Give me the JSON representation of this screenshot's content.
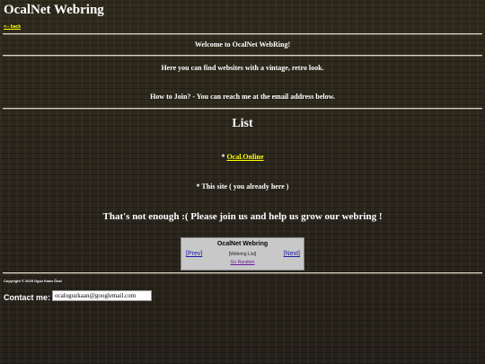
{
  "header": {
    "title": "OcalNet Webring",
    "back_label": "<-- back"
  },
  "intro": {
    "welcome": "Welcome to OcalNet WebRing!",
    "find": "Here you can find websites with a vintage, retro look.",
    "join": "How to Join? - You can reach me at the email address below."
  },
  "list": {
    "heading": "List",
    "items": [
      {
        "prefix": "* ",
        "link": "Ocal.Online"
      },
      {
        "text": "* This site ( you already here )"
      }
    ]
  },
  "cta": "That's not enough :( Please join us and help us grow our webring !",
  "webring": {
    "title": "OcalNet Webring",
    "prev": "[Prev]",
    "list": "[Webring List]",
    "next": "[Next]",
    "random": "Go Random"
  },
  "footer": {
    "copyright": "Copyright © 2025 Oguz Kaan Öcal",
    "contact_label": "Contact me:",
    "email": "ocaloguzkaan@googlemail.com"
  }
}
